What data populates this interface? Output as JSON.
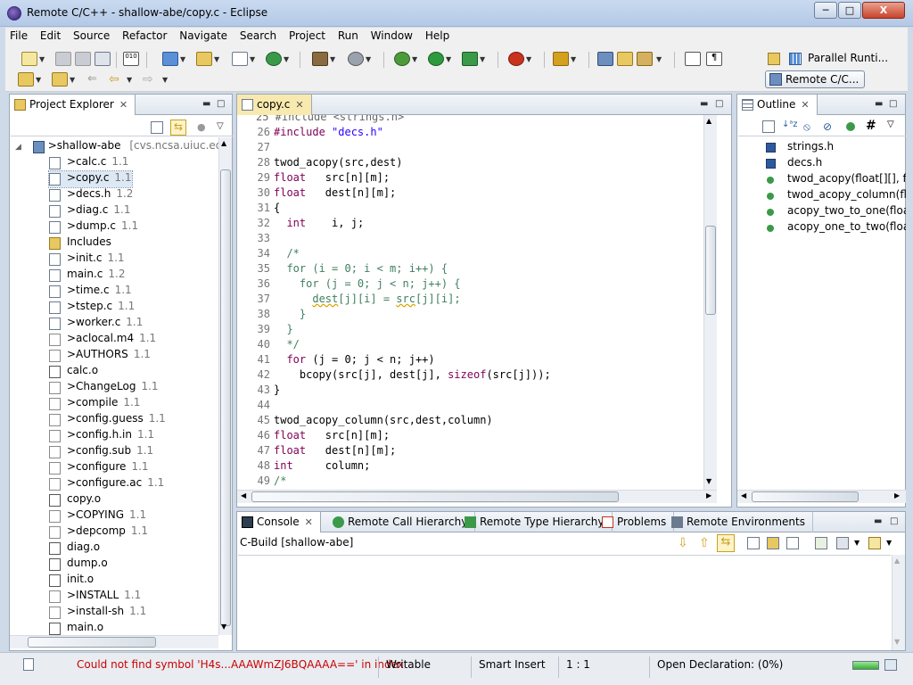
{
  "window": {
    "title": "Remote C/C++ - shallow-abe/copy.c - Eclipse",
    "minimize": "─",
    "maximize": "□",
    "close": "X"
  },
  "menu": [
    "File",
    "Edit",
    "Source",
    "Refactor",
    "Navigate",
    "Search",
    "Project",
    "Run",
    "Window",
    "Help"
  ],
  "perspectives": [
    {
      "label": "Parallel Runti...",
      "icon": "grid-icon"
    },
    {
      "label": "Remote C/C...",
      "icon": "remote-cpp-icon",
      "active": true
    }
  ],
  "explorer": {
    "tab_label": "Project Explorer",
    "project": {
      "name": ">shallow-abe",
      "repo": "[cvs.ncsa.uiuc.edu]"
    },
    "items": [
      {
        "name": ">calc.c",
        "ver": "1.1",
        "type": "c"
      },
      {
        "name": ">copy.c",
        "ver": "1.1",
        "type": "c",
        "selected": true
      },
      {
        "name": ">decs.h",
        "ver": "1.2",
        "type": "h"
      },
      {
        "name": ">diag.c",
        "ver": "1.1",
        "type": "c"
      },
      {
        "name": ">dump.c",
        "ver": "1.1",
        "type": "c"
      },
      {
        "name": "Includes",
        "ver": "",
        "type": "includes"
      },
      {
        "name": ">init.c",
        "ver": "1.1",
        "type": "c"
      },
      {
        "name": "main.c",
        "ver": "1.2",
        "type": "c"
      },
      {
        "name": ">time.c",
        "ver": "1.1",
        "type": "c"
      },
      {
        "name": ">tstep.c",
        "ver": "1.1",
        "type": "c"
      },
      {
        "name": ">worker.c",
        "ver": "1.1",
        "type": "c"
      },
      {
        "name": ">aclocal.m4",
        "ver": "1.1",
        "type": "file"
      },
      {
        "name": ">AUTHORS",
        "ver": "1.1",
        "type": "file"
      },
      {
        "name": "calc.o",
        "ver": "",
        "type": "obj"
      },
      {
        "name": ">ChangeLog",
        "ver": "1.1",
        "type": "file"
      },
      {
        "name": ">compile",
        "ver": "1.1",
        "type": "file"
      },
      {
        "name": ">config.guess",
        "ver": "1.1",
        "type": "file"
      },
      {
        "name": ">config.h.in",
        "ver": "1.1",
        "type": "file"
      },
      {
        "name": ">config.sub",
        "ver": "1.1",
        "type": "file"
      },
      {
        "name": ">configure",
        "ver": "1.1",
        "type": "file"
      },
      {
        "name": ">configure.ac",
        "ver": "1.1",
        "type": "file"
      },
      {
        "name": "copy.o",
        "ver": "",
        "type": "obj"
      },
      {
        "name": ">COPYING",
        "ver": "1.1",
        "type": "file"
      },
      {
        "name": ">depcomp",
        "ver": "1.1",
        "type": "file"
      },
      {
        "name": "diag.o",
        "ver": "",
        "type": "obj"
      },
      {
        "name": "dump.o",
        "ver": "",
        "type": "obj"
      },
      {
        "name": "init.o",
        "ver": "",
        "type": "obj"
      },
      {
        "name": ">INSTALL",
        "ver": "1.1",
        "type": "file"
      },
      {
        "name": ">install-sh",
        "ver": "1.1",
        "type": "file"
      },
      {
        "name": "main.o",
        "ver": "",
        "type": "obj"
      }
    ]
  },
  "editor": {
    "tab_label": "copy.c",
    "partial_top": "25 #include <strings.h>",
    "lines": [
      {
        "n": "26",
        "segs": [
          [
            "kw",
            "#include "
          ],
          [
            "str",
            "\"decs.h\""
          ]
        ]
      },
      {
        "n": "27",
        "segs": []
      },
      {
        "n": "28",
        "segs": [
          [
            "",
            "twod_acopy(src,dest)"
          ]
        ]
      },
      {
        "n": "29",
        "segs": [
          [
            "kw",
            "float"
          ],
          [
            "",
            "   src[n][m];"
          ]
        ]
      },
      {
        "n": "30",
        "segs": [
          [
            "kw",
            "float"
          ],
          [
            "",
            "   dest[n][m];"
          ]
        ]
      },
      {
        "n": "31",
        "segs": [
          [
            "",
            "{"
          ]
        ]
      },
      {
        "n": "32",
        "segs": [
          [
            "",
            "  "
          ],
          [
            "kw",
            "int"
          ],
          [
            "",
            "    i, j;"
          ]
        ]
      },
      {
        "n": "33",
        "segs": []
      },
      {
        "n": "34",
        "segs": [
          [
            "cm",
            "  /*"
          ]
        ]
      },
      {
        "n": "35",
        "segs": [
          [
            "cm",
            "  for (i = 0; i < m; i++) {"
          ]
        ]
      },
      {
        "n": "36",
        "segs": [
          [
            "cm",
            "    for (j = 0; j < n; j++) {"
          ]
        ]
      },
      {
        "n": "37",
        "segs": [
          [
            "cm",
            "      "
          ],
          [
            "cmsq",
            "dest"
          ],
          [
            "cm",
            "[j][i] = "
          ],
          [
            "cmsq",
            "src"
          ],
          [
            "cm",
            "[j][i];"
          ]
        ]
      },
      {
        "n": "38",
        "segs": [
          [
            "cm",
            "    }"
          ]
        ]
      },
      {
        "n": "39",
        "segs": [
          [
            "cm",
            "  }"
          ]
        ]
      },
      {
        "n": "40",
        "segs": [
          [
            "cm",
            "  */"
          ]
        ]
      },
      {
        "n": "41",
        "segs": [
          [
            "",
            "  "
          ],
          [
            "kw",
            "for"
          ],
          [
            "",
            " (j = 0; j < n; j++)"
          ]
        ]
      },
      {
        "n": "42",
        "segs": [
          [
            "",
            "    bcopy(src[j], dest[j], "
          ],
          [
            "kw",
            "sizeof"
          ],
          [
            "",
            "(src[j]));"
          ]
        ]
      },
      {
        "n": "43",
        "segs": [
          [
            "",
            "}"
          ]
        ]
      },
      {
        "n": "44",
        "segs": []
      },
      {
        "n": "45",
        "segs": [
          [
            "",
            "twod_acopy_column(src,dest,column)"
          ]
        ]
      },
      {
        "n": "46",
        "segs": [
          [
            "kw",
            "float"
          ],
          [
            "",
            "   src[n][m];"
          ]
        ]
      },
      {
        "n": "47",
        "segs": [
          [
            "kw",
            "float"
          ],
          [
            "",
            "   dest[n][m];"
          ]
        ]
      },
      {
        "n": "48",
        "segs": [
          [
            "kw",
            "int"
          ],
          [
            "",
            "     column;"
          ]
        ]
      },
      {
        "n": "49",
        "segs": [
          [
            "cm",
            "/*"
          ]
        ]
      }
    ]
  },
  "outline": {
    "tab_label": "Outline",
    "items": [
      {
        "label": "strings.h",
        "icon": "include-icon"
      },
      {
        "label": "decs.h",
        "icon": "include-icon"
      },
      {
        "label": "twod_acopy(float[][], flo",
        "icon": "function-icon"
      },
      {
        "label": "twod_acopy_column(flo",
        "icon": "function-icon"
      },
      {
        "label": "acopy_two_to_one(float",
        "icon": "function-icon"
      },
      {
        "label": "acopy_one_to_two(float",
        "icon": "function-icon"
      }
    ]
  },
  "bottom": {
    "tabs": [
      "Console",
      "Remote Call Hierarchy",
      "Remote Type Hierarchy",
      "Problems",
      "Remote Environments"
    ],
    "console_title": "C-Build [shallow-abe]"
  },
  "status": {
    "message": "Could not find symbol 'H4s...AAAWmZJ6BQAAAA==' in index",
    "writable": "Writable",
    "insert_mode": "Smart Insert",
    "position": "1 : 1",
    "progress": "Open Declaration: (0%)",
    "error_color": "#cc0000"
  }
}
